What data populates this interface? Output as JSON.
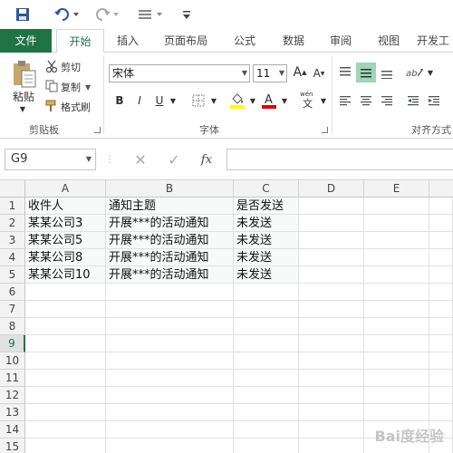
{
  "tabs": {
    "file": "文件",
    "items": [
      "开始",
      "插入",
      "页面布局",
      "公式",
      "数据",
      "审阅",
      "视图",
      "开发工"
    ]
  },
  "ribbon": {
    "clipboard": {
      "paste": "粘贴",
      "cut": "剪切",
      "copy": "复制",
      "format_painter": "格式刷",
      "group_label": "剪贴板"
    },
    "font": {
      "font_name": "宋体",
      "font_size": "11",
      "group_label": "字体"
    },
    "alignment": {
      "group_label": "对齐方式"
    }
  },
  "formula_bar": {
    "name_box": "G9",
    "fx": "fx",
    "content": ""
  },
  "grid": {
    "columns": [
      "A",
      "B",
      "C",
      "D",
      "E"
    ],
    "rows": [
      "1",
      "2",
      "3",
      "4",
      "5",
      "6",
      "7",
      "8",
      "9",
      "10",
      "11",
      "12",
      "13",
      "14",
      "15"
    ],
    "selected_row": "9",
    "data": [
      [
        "收件人",
        "通知主题",
        "是否发送"
      ],
      [
        "某某公司3",
        "开展***的活动通知",
        "未发送"
      ],
      [
        "某某公司5",
        "开展***的活动通知",
        "未发送"
      ],
      [
        "某某公司8",
        "开展***的活动通知",
        "未发送"
      ],
      [
        "某某公司10",
        "开展***的活动通知",
        "未发送"
      ]
    ]
  },
  "colors": {
    "accent": "#217346"
  }
}
